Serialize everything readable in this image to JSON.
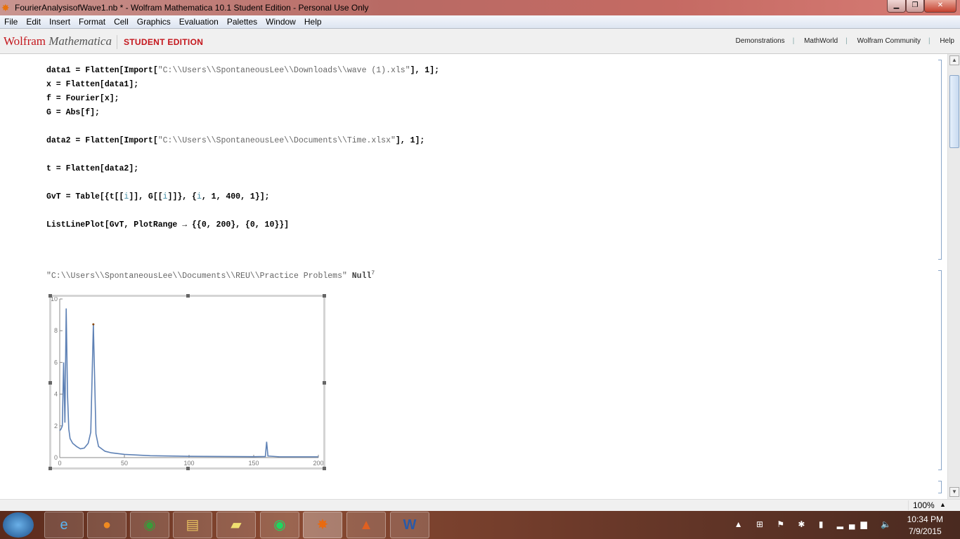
{
  "window": {
    "title": "FourierAnalysisofWave1.nb * - Wolfram Mathematica 10.1 Student Edition - Personal Use Only",
    "icon": "mathematica-icon"
  },
  "menu": [
    "File",
    "Edit",
    "Insert",
    "Format",
    "Cell",
    "Graphics",
    "Evaluation",
    "Palettes",
    "Window",
    "Help"
  ],
  "brand": {
    "logo": "Wolfram Mathematica",
    "edition": "STUDENT EDITION",
    "links": [
      "Demonstrations",
      "MathWorld",
      "Wolfram Community",
      "Help"
    ]
  },
  "cells": {
    "l1a": "data1 = Flatten[Import[",
    "l1s": "\"C:\\\\Users\\\\SpontaneousLee\\\\Downloads\\\\wave (1).xls\"",
    "l1b": "], 1];",
    "l2": "x = Flatten[data1];",
    "l3": "f = Fourier[x];",
    "l4": "G = Abs[f];",
    "l5a": "data2 = Flatten[Import[",
    "l5s": "\"C:\\\\Users\\\\SpontaneousLee\\\\Documents\\\\Time.xlsx\"",
    "l5b": "], 1];",
    "l6": "t = Flatten[data2];",
    "l7a": "GvT = Table[{t[[",
    "l7i": "i",
    "l7b": "]], G[[",
    "l7c": "]]}, {",
    "l7d": ", 1, 400, 1}];",
    "l8": "ListLinePlot[GvT, PlotRange → {{0, 200}, {0, 10}}]",
    "out_str": "\"C:\\\\Users\\\\SpontaneousLee\\\\Documents\\\\REU\\\\Practice Problems\"",
    "out_null": " Null",
    "out_sup": "7"
  },
  "chart_data": {
    "type": "line",
    "xlim": [
      0,
      200
    ],
    "ylim": [
      0,
      10
    ],
    "xticks": [
      "0",
      "50",
      "100",
      "150",
      "200"
    ],
    "yticks": [
      "0",
      "2",
      "4",
      "6",
      "8",
      "10"
    ],
    "x": [
      0,
      1,
      2,
      3,
      4,
      5,
      6,
      7,
      8,
      10,
      13,
      16,
      19,
      22,
      24,
      26,
      28,
      30,
      35,
      40,
      50,
      70,
      100,
      150,
      159,
      160,
      161,
      170,
      200
    ],
    "y": [
      1.7,
      1.8,
      2,
      6,
      2.2,
      9.4,
      4,
      1.8,
      1.2,
      0.9,
      0.7,
      0.55,
      0.6,
      0.9,
      1.6,
      8.4,
      1.5,
      0.7,
      0.4,
      0.3,
      0.2,
      0.12,
      0.08,
      0.06,
      0.07,
      1.0,
      0.1,
      0.05,
      0.05
    ],
    "color": "#5e81b5"
  },
  "status": {
    "zoom": "100%"
  },
  "taskbar": {
    "apps": [
      "internet-explorer",
      "firefox",
      "chrome",
      "file-explorer",
      "sticky-notes",
      "spotify",
      "mathematica",
      "matlab",
      "word"
    ],
    "time": "10:34 PM",
    "date": "7/9/2015"
  }
}
